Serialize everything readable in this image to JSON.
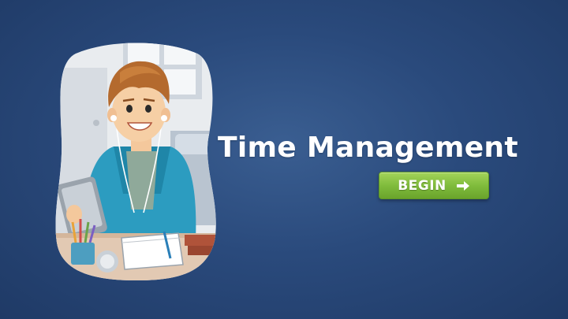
{
  "slide": {
    "title": "Time Management",
    "begin_label": "BEGIN",
    "arrow_icon": "arrow-right-icon",
    "illustration": "student-studying-illustration"
  },
  "colors": {
    "background": "#2a4a7c",
    "button": "#80bc3c",
    "title_text": "#ffffff"
  }
}
